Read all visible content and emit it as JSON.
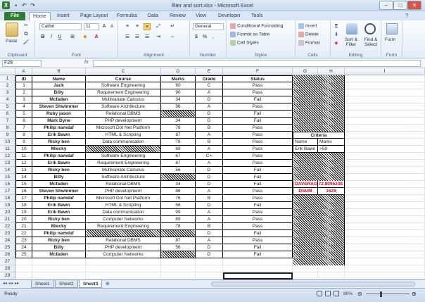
{
  "window": {
    "title": "filter and sort.xlsx  -  Microsoft Excel",
    "controls": [
      "–",
      "□",
      "✕"
    ]
  },
  "ribbon_tabs": [
    "File",
    "Home",
    "Insert",
    "Page Layout",
    "Formulas",
    "Data",
    "Review",
    "View",
    "Developer",
    "Tools"
  ],
  "ribbon": {
    "clipboard": {
      "label": "Clipboard",
      "paste": "Paste"
    },
    "font": {
      "label": "Font",
      "name": "Calibri",
      "size": "11",
      "bold": "B",
      "italic": "I",
      "underline": "U"
    },
    "alignment": {
      "label": "Alignment"
    },
    "number": {
      "label": "Number",
      "format": "General",
      "currency": "$",
      "percent": "%",
      "comma": ","
    },
    "styles": {
      "label": "Styles",
      "conditional": "Conditional Formatting",
      "table": "Format as Table",
      "cell": "Cell Styles"
    },
    "cells": {
      "label": "Cells",
      "insert": "Insert",
      "delete": "Delete",
      "format": "Format"
    },
    "editing": {
      "label": "Editing",
      "sort": "Sort & Filter",
      "find": "Find & Select",
      "sigma": "Σ"
    },
    "form": {
      "label": "Form",
      "button": "Form"
    }
  },
  "formula_bar": {
    "name_box": "F29",
    "fx": "fx",
    "content": ""
  },
  "columns": [
    "A",
    "B",
    "C",
    "D",
    "E",
    "F",
    "G",
    "H",
    "I"
  ],
  "headers": [
    "ID",
    "Name",
    "Course",
    "Marks",
    "Grade",
    "Status"
  ],
  "rows": [
    [
      "1",
      "Jack",
      "Software Engineering",
      "60",
      "C",
      "Pass"
    ],
    [
      "2",
      "Billy",
      "Requirement Engineering",
      "90",
      "A",
      "Pass"
    ],
    [
      "3",
      "Mcfaden",
      "Multivariate Calculus",
      "34",
      "D",
      "Fail"
    ],
    [
      "4",
      "Steven Shwimmer",
      "Software Architecture",
      "96",
      "A",
      "Pass"
    ],
    [
      "5",
      "Ruby jason",
      "Relational DBMS",
      "",
      "D",
      "Fail"
    ],
    [
      "6",
      "Mark Dyne",
      "PHP development",
      "34",
      "D",
      "Fail"
    ],
    [
      "7",
      "Philip namdaf",
      "Microsoft Dot Net Platform",
      "78",
      "B",
      "Pass"
    ],
    [
      "8",
      "Erik Bawn",
      "HTML & Scripting",
      "87",
      "A",
      "Pass"
    ],
    [
      "9",
      "Ricky ben",
      "Data communication",
      "78",
      "B",
      "Pass"
    ],
    [
      "10",
      "Miecky",
      "",
      "89",
      "A",
      "Pass"
    ],
    [
      "11",
      "Philip namdaf",
      "Software Engineering",
      "67",
      "C+",
      "Pass"
    ],
    [
      "12",
      "Erik Bawn",
      "Requirement Engineering",
      "87",
      "A",
      "Pass"
    ],
    [
      "13",
      "Ricky ben",
      "Multivariate Calculus",
      "56",
      "D",
      "Fail"
    ],
    [
      "14",
      "Billy",
      "Software Architecture",
      "",
      "D",
      "Fail"
    ],
    [
      "15",
      "Mcfaden",
      "Relational DBMS",
      "34",
      "D",
      "Fail"
    ],
    [
      "16",
      "Steven Shwimmer",
      "PHP development",
      "98",
      "A",
      "Pass"
    ],
    [
      "17",
      "Philip namdaf",
      "Microsoft Dot Net Platform",
      "76",
      "B",
      "Pass"
    ],
    [
      "18",
      "Erik Bawn",
      "HTML & Scripting",
      "56",
      "D",
      "Fail"
    ],
    [
      "19",
      "Erik Bawn",
      "Data communication",
      "99",
      "A",
      "Pass"
    ],
    [
      "20",
      "Ricky ben",
      "Computer Networks",
      "89",
      "A",
      "Pass"
    ],
    [
      "21",
      "Miecky",
      "Requirement Engineering",
      "78",
      "B",
      "Pass"
    ],
    [
      "22",
      "Philip namdaf",
      "",
      "",
      "D",
      "Fail"
    ],
    [
      "23",
      "Ricky ben",
      "Relational DBMS",
      "87",
      "A",
      "Pass"
    ],
    [
      "24",
      "Billy",
      "PHP development",
      "56",
      "D",
      "Fail"
    ],
    [
      "25",
      "Mcfaden",
      "Computer Networks",
      "",
      "D",
      "Fail"
    ]
  ],
  "criteria": {
    "title": "Criteria",
    "col1": "Name",
    "col2": "Marks",
    "val1": "Erik Bawn",
    "val2": ">59",
    "daverage_label": "DAVERAGE",
    "daverage_value": "72.8095238",
    "dsum_label": "DSUM",
    "dsum_value": "1529"
  },
  "sheets": [
    "Sheet1",
    "Sheet2",
    "Sheet3"
  ],
  "status": {
    "ready": "Ready",
    "zoom": "80%"
  }
}
